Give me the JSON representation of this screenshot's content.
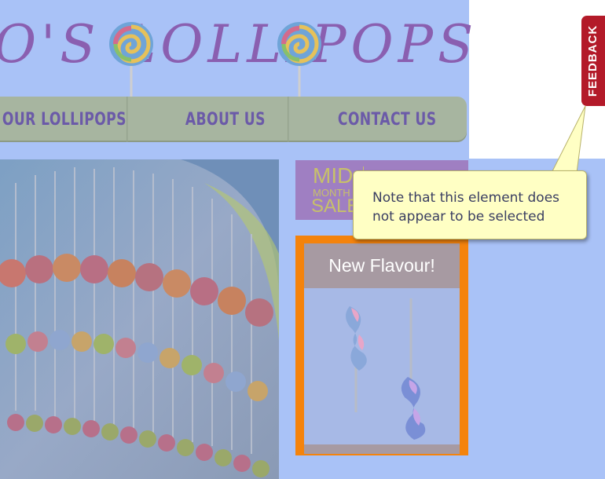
{
  "logo": {
    "text": "O'S LOLLIPOPS"
  },
  "nav": {
    "items": [
      {
        "label": "OUR LOLLIPOPS"
      },
      {
        "label": "ABOUT US"
      },
      {
        "label": "CONTACT US"
      }
    ]
  },
  "promo": {
    "line1": "MID",
    "line2": "MONTH",
    "line3": "SALE"
  },
  "flavour": {
    "title": "New Flavour!"
  },
  "feedback": {
    "label": "FEEDBACK"
  },
  "callout": {
    "text": "Note that this element does not appear to be selected"
  },
  "colors": {
    "page_tint": "#a9c2f7",
    "nav_bg": "#a7b5a0",
    "nav_text": "#6b5aa8",
    "logo_text": "#8a5fb0",
    "promo_bg": "#9f7fc2",
    "flavour_border": "#f4830c",
    "feedback_bg": "#b31a29",
    "callout_bg": "#ffffc4"
  }
}
